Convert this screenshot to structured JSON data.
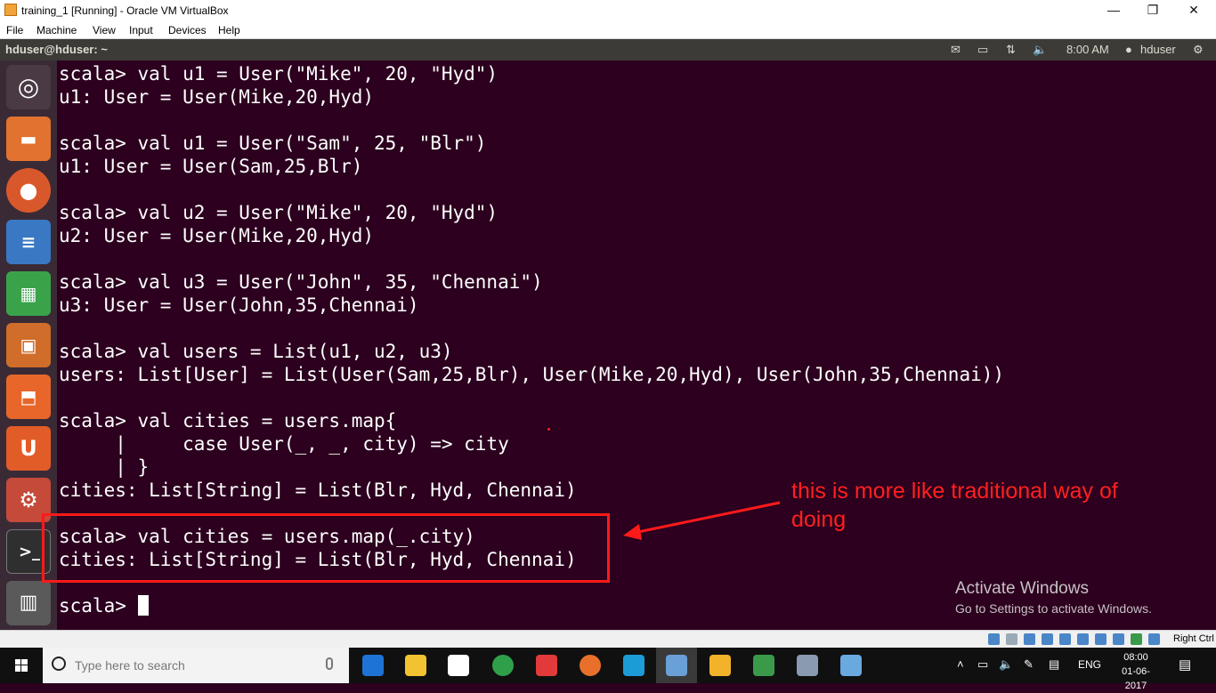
{
  "host_window": {
    "title": "training_1 [Running] - Oracle VM VirtualBox",
    "minimize": "—",
    "maximize": "❐",
    "close": "✕"
  },
  "vbox_menu": [
    "File",
    "Machine",
    "View",
    "Input",
    "Devices",
    "Help"
  ],
  "ubuntu_panel": {
    "window_title": "hduser@hduser: ~",
    "time": "8:00 AM",
    "user": "hduser"
  },
  "launcher": [
    "ubuntu-dash-icon",
    "files-icon",
    "firefox-icon",
    "writer-icon",
    "calc-icon",
    "impress-icon",
    "software-center-icon",
    "ubuntu-one-icon",
    "settings-icon",
    "terminal-icon",
    "trash-icon"
  ],
  "terminal": {
    "lines": [
      "scala> val u1 = User(\"Mike\", 20, \"Hyd\")",
      "u1: User = User(Mike,20,Hyd)",
      "",
      "scala> val u1 = User(\"Sam\", 25, \"Blr\")",
      "u1: User = User(Sam,25,Blr)",
      "",
      "scala> val u2 = User(\"Mike\", 20, \"Hyd\")",
      "u2: User = User(Mike,20,Hyd)",
      "",
      "scala> val u3 = User(\"John\", 35, \"Chennai\")",
      "u3: User = User(John,35,Chennai)",
      "",
      "scala> val users = List(u1, u2, u3)",
      "users: List[User] = List(User(Sam,25,Blr), User(Mike,20,Hyd), User(John,35,Chennai))",
      "",
      "scala> val cities = users.map{",
      "     |     case User(_, _, city) => city",
      "     | }",
      "cities: List[String] = List(Blr, Hyd, Chennai)",
      "",
      "scala> val cities = users.map(_.city)",
      "cities: List[String] = List(Blr, Hyd, Chennai)",
      ""
    ],
    "prompt": "scala> "
  },
  "annotation": {
    "text": "this is more like traditional way of doing",
    "color": "#ff2020"
  },
  "watermark": {
    "title": "Activate Windows",
    "subtitle": "Go to Settings to activate Windows."
  },
  "vbox_status": {
    "host_key": "Right Ctrl"
  },
  "taskbar": {
    "search_placeholder": "Type here to search",
    "language": "ENG",
    "time": "08:00",
    "date": "01-06-2017"
  },
  "colors": {
    "terminal_bg": "#2c001e",
    "panel_bg": "#3c3b37",
    "highlight": "#ff1a1a"
  }
}
